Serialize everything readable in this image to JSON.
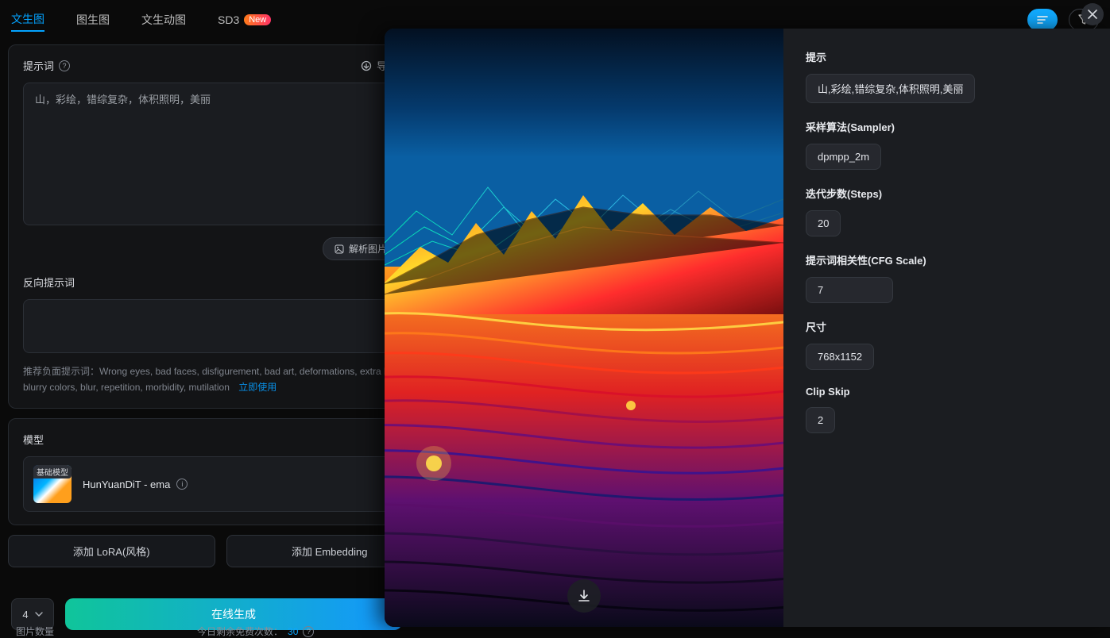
{
  "tabs": {
    "txt2img": "文生图",
    "img2img": "图生图",
    "txt2anim": "文生动图",
    "sd3": "SD3",
    "sd3_badge": "New"
  },
  "prompt": {
    "title": "提示词",
    "import": "导入生成",
    "value": "山，彩绘，错综复杂，体积照明，美丽",
    "parse_btn": "解析图片提示"
  },
  "negative": {
    "title": "反向提示词",
    "hint_prefix": "推荐负面提示词：",
    "hint_text": "Wrong eyes, bad faces, disfigurement, bad art, deformations, extra limbs, blurry colors, blur, repetition, morbidity, mutilation",
    "use_now": "立即使用"
  },
  "model": {
    "section": "模型",
    "badge": "基础模型",
    "name": "HunYuanDiT - ema"
  },
  "extra": {
    "lora": "添加 LoRA(风格)",
    "embedding": "添加 Embedding"
  },
  "footer": {
    "count": "4",
    "generate": "在线生成",
    "img_count_label": "图片数量",
    "quota_label": "今日剩余免费次数：",
    "quota_value": "30"
  },
  "modal": {
    "labels": {
      "prompt": "提示",
      "sampler": "采样算法(Sampler)",
      "steps": "迭代步数(Steps)",
      "cfg": "提示词相关性(CFG Scale)",
      "size": "尺寸",
      "clipskip": "Clip Skip"
    },
    "values": {
      "prompt": "山,彩绘,错综复杂,体积照明,美丽",
      "sampler": "dpmpp_2m",
      "steps": "20",
      "cfg": "7",
      "size": "768x1152",
      "clipskip": "2"
    }
  }
}
